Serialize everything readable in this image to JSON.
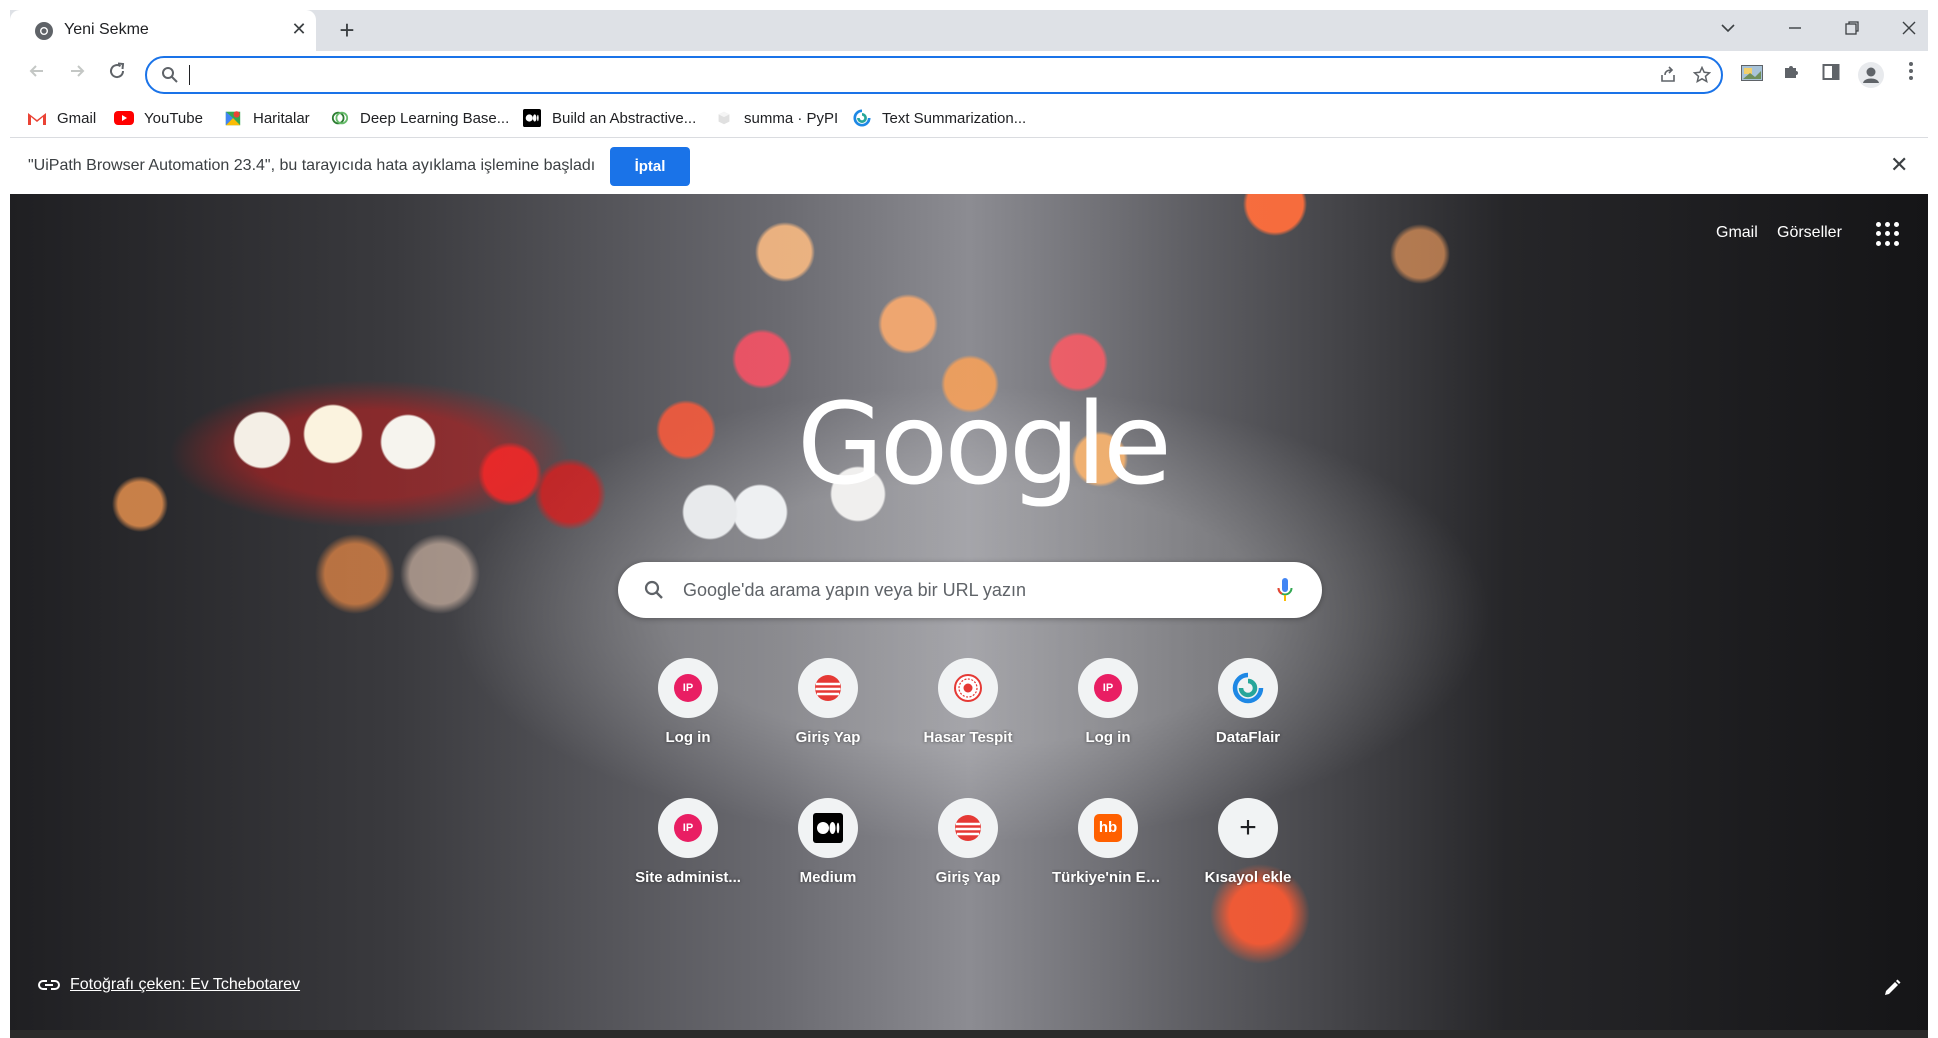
{
  "tab": {
    "title": "Yeni Sekme",
    "close": "✕"
  },
  "newtab": "+",
  "window": {
    "dropdown": "⌄",
    "minimize": "—",
    "restore": "❐",
    "close": "✕"
  },
  "omnibox": {
    "value": "",
    "placeholder": ""
  },
  "bookmarks": [
    {
      "label": "Gmail",
      "icon": "gmail-icon"
    },
    {
      "label": "YouTube",
      "icon": "youtube-icon"
    },
    {
      "label": "Haritalar",
      "icon": "maps-icon"
    },
    {
      "label": "Deep Learning Base...",
      "icon": "deep-learning-icon"
    },
    {
      "label": "Build an Abstractive...",
      "icon": "medium-icon"
    },
    {
      "label": "summa · PyPI",
      "icon": "pypi-icon"
    },
    {
      "label": "Text Summarization...",
      "icon": "dataflair-icon"
    }
  ],
  "infobar": {
    "message": "\"UiPath Browser Automation 23.4\", bu tarayıcıda hata ayıklama işlemine başladı",
    "cancel": "İptal",
    "close": "✕"
  },
  "ntp": {
    "gmail": "Gmail",
    "images": "Görseller",
    "logo": "Google",
    "search_placeholder": "Google'da arama yapın veya bir URL yazın",
    "credit": "Fotoğrafı çeken: Ev Tchebotarev"
  },
  "shortcuts": [
    {
      "label": "Log in",
      "icon": "ip-icon",
      "glyph": "IP"
    },
    {
      "label": "Giriş Yap",
      "icon": "striped-globe-icon",
      "glyph": ""
    },
    {
      "label": "Hasar Tespit",
      "icon": "seal-icon",
      "glyph": ""
    },
    {
      "label": "Log in",
      "icon": "ip-icon",
      "glyph": "IP"
    },
    {
      "label": "DataFlair",
      "icon": "dataflair-icon",
      "glyph": ""
    },
    {
      "label": "Site administ...",
      "icon": "ip-icon",
      "glyph": "IP"
    },
    {
      "label": "Medium",
      "icon": "medium-icon",
      "glyph": ""
    },
    {
      "label": "Giriş Yap",
      "icon": "striped-globe-icon",
      "glyph": ""
    },
    {
      "label": "Türkiye'nin En...",
      "icon": "hb-icon",
      "glyph": "hb"
    },
    {
      "label": "Kısayol ekle",
      "icon": "plus-icon",
      "glyph": "+"
    }
  ],
  "colors": {
    "accent": "#1a73e8",
    "tabstrip": "#dee1e6",
    "ip": "#e91e63",
    "hb": "#ff6000"
  }
}
